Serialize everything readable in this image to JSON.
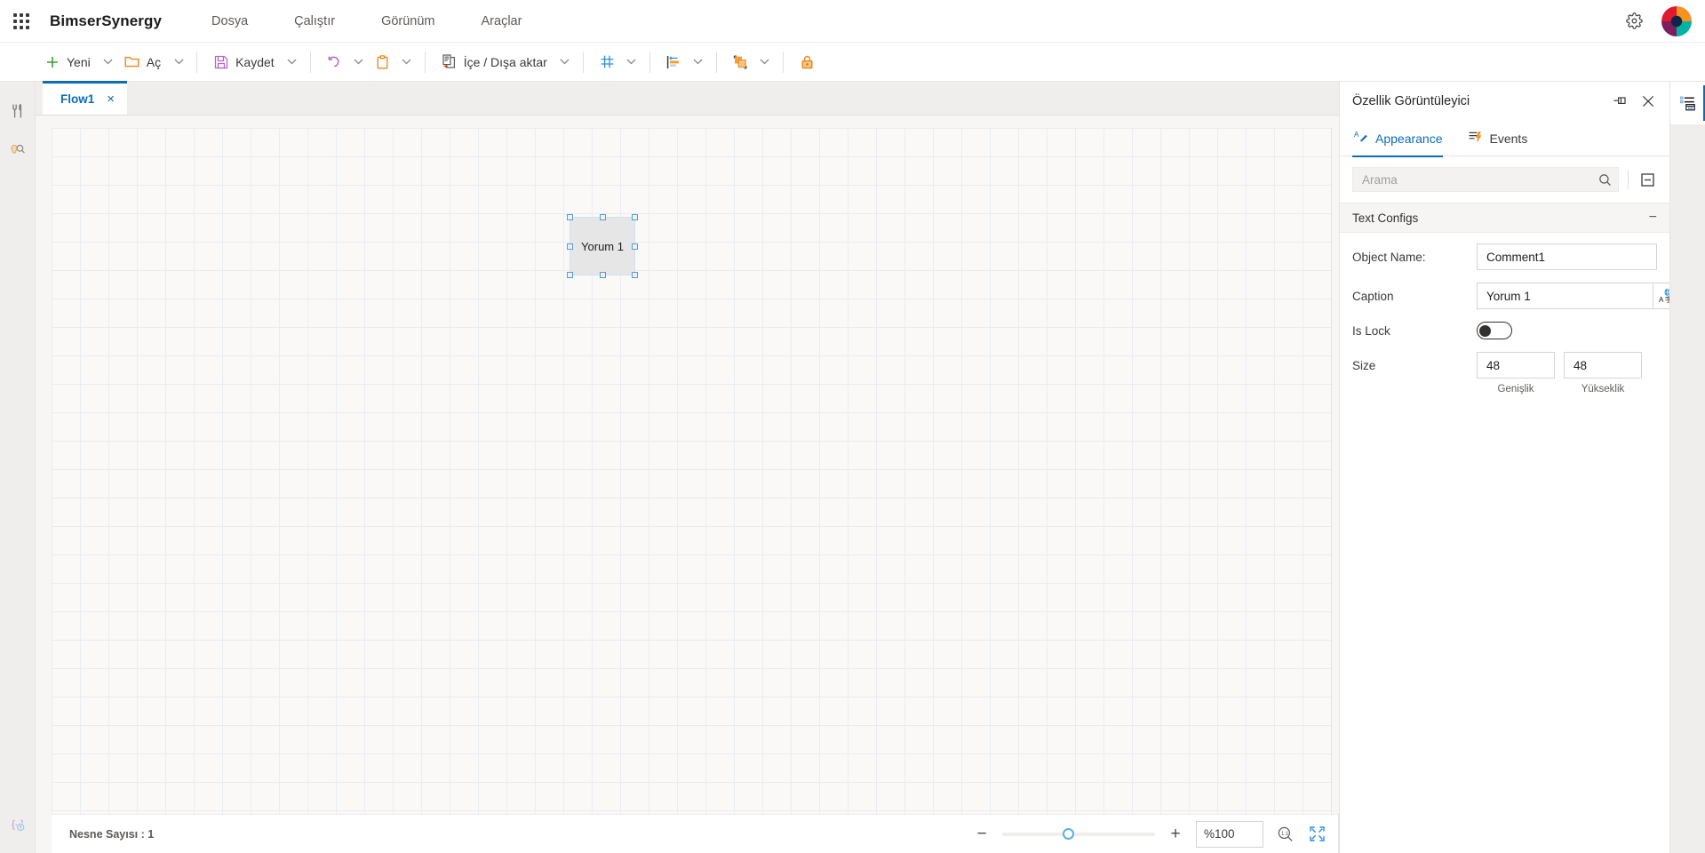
{
  "app": {
    "brand": "BimserSynergy",
    "menu": [
      "Dosya",
      "Çalıştır",
      "Görünüm",
      "Araçlar"
    ],
    "waffle_icon": "app-launcher-icon",
    "gear_icon": "gear-icon",
    "logo_icon": "bimser-logo-icon"
  },
  "toolbar": {
    "new": {
      "label": "Yeni",
      "icon": "plus-icon"
    },
    "open": {
      "label": "Aç",
      "icon": "folder-icon"
    },
    "save": {
      "label": "Kaydet",
      "icon": "floppy-disk-icon"
    },
    "undo": {
      "label": "",
      "icon": "undo-icon"
    },
    "paste": {
      "label": "",
      "icon": "clipboard-icon"
    },
    "import_export": {
      "label": "İçe / Dışa aktar",
      "icon": "import-export-icon"
    },
    "grid": {
      "label": "",
      "icon": "grid-icon"
    },
    "align": {
      "label": "",
      "icon": "align-left-icon"
    },
    "arrange": {
      "label": "",
      "icon": "bring-to-front-icon"
    },
    "lock": {
      "label": "",
      "icon": "lock-icon"
    },
    "caret": "chevron-down-icon"
  },
  "leftrail": {
    "tools_icon": "wrench-tools-icon",
    "inspect_icon": "magnifier-inspect-icon",
    "code_icon": "code-braces-icon"
  },
  "tabs": [
    {
      "label": "Flow1",
      "close": "×",
      "active": true
    }
  ],
  "canvas": {
    "shape": {
      "caption": "Yorum 1",
      "selected": true,
      "width": 48,
      "height": 48
    }
  },
  "statusbar": {
    "object_count_label": "Nesne Sayısı : 1",
    "zoom_out": "−",
    "zoom_in": "+",
    "zoom_value": "%100",
    "actual_size_icon": "zoom-one-to-one-icon",
    "fit_screen_icon": "fit-to-screen-icon",
    "slider_position_pct": 40
  },
  "properties": {
    "title": "Özellik Görüntüleyici",
    "pin_icon": "pin-icon",
    "close_icon": "close-icon",
    "tabs": [
      {
        "label": "Appearance",
        "icon": "appearance-pen-icon",
        "active": true
      },
      {
        "label": "Events",
        "icon": "events-lightning-icon",
        "active": false
      }
    ],
    "search": {
      "placeholder": "Arama",
      "value": "",
      "icon": "search-icon"
    },
    "collapse_all_icon": "collapse-all-icon",
    "section": {
      "title": "Text Configs",
      "toggle": "−"
    },
    "fields": {
      "object_name": {
        "label": "Object Name:",
        "value": "Comment1"
      },
      "caption": {
        "label": "Caption",
        "value": "Yorum 1",
        "translate_icon": "translate-icon"
      },
      "is_lock": {
        "label": "Is Lock",
        "value": "off"
      },
      "size": {
        "label": "Size",
        "width": "48",
        "height": "48",
        "width_sub": "Genişlik",
        "height_sub": "Yükseklik"
      }
    }
  },
  "rightrail": {
    "properties_icon": "properties-list-icon"
  },
  "colors": {
    "accent": "#0b6cb8",
    "green": "#3f9c35",
    "orange": "#e8871e",
    "purple": "#b26ac4",
    "blue": "#2c8ed6"
  }
}
